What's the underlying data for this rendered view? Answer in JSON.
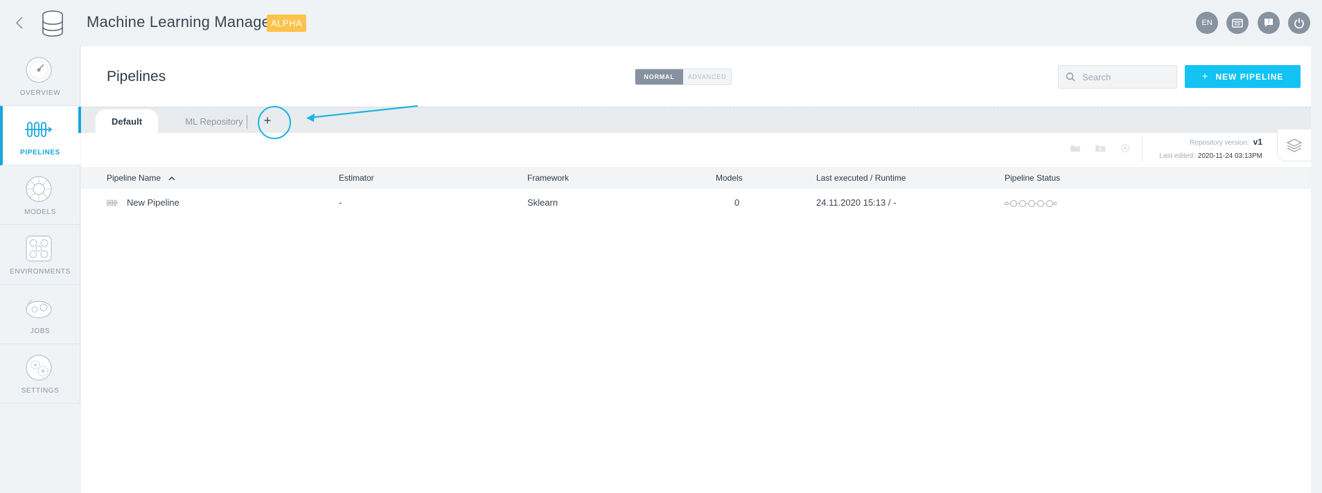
{
  "app": {
    "title": "Machine Learning Manager",
    "badge": "ALPHA",
    "lang": "EN",
    "accent_color": "#12c3f4",
    "badge_color": "#ffc24a"
  },
  "header_icons": [
    "back-chevron-icon",
    "database-icon",
    "calendar-icon",
    "help-chat-icon",
    "power-icon"
  ],
  "sidebar": {
    "items": [
      {
        "label": "OVERVIEW",
        "icon": "speedometer-icon",
        "active": false
      },
      {
        "label": "PIPELINES",
        "icon": "pipeline-icon",
        "active": true
      },
      {
        "label": "MODELS",
        "icon": "models-icon",
        "active": false
      },
      {
        "label": "ENVIRONMENTS",
        "icon": "environments-icon",
        "active": false
      },
      {
        "label": "JOBS",
        "icon": "jobs-icon",
        "active": false
      },
      {
        "label": "SETTINGS",
        "icon": "settings-icon",
        "active": false
      }
    ]
  },
  "page": {
    "title": "Pipelines",
    "modes": [
      "NORMAL",
      "ADVANCED"
    ],
    "active_mode": "NORMAL",
    "search_placeholder": "Search",
    "new_button": "NEW PIPELINE"
  },
  "tabs": {
    "items": [
      "Default",
      "ML Repository"
    ],
    "active": "Default",
    "add_label": "+"
  },
  "repository": {
    "version_label": "Repository version:",
    "version": "v1",
    "edited_label": "Last edited:",
    "edited": "2020-11-24 03:13PM"
  },
  "table": {
    "columns": [
      "Pipeline Name",
      "Estimator",
      "Framework",
      "Models",
      "Last executed / Runtime",
      "Pipeline Status"
    ],
    "rows": [
      {
        "name": "New Pipeline",
        "estimator": "-",
        "framework": "Sklearn",
        "models": "0",
        "last_executed": "24.11.2020 15:13 / -",
        "status": "not-run"
      }
    ]
  }
}
